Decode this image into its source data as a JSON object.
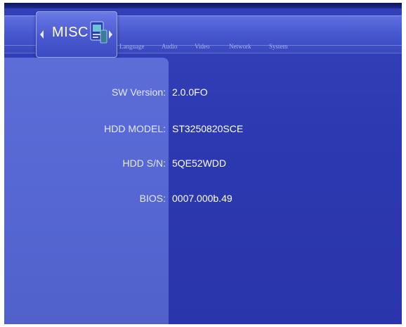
{
  "menu": {
    "selected_tab": "MISC",
    "tabs": [
      {
        "label": "Language"
      },
      {
        "label": "Audio"
      },
      {
        "label": "Video"
      },
      {
        "label": "Network"
      },
      {
        "label": "System"
      }
    ],
    "icons": {
      "left": "arrow-left-icon",
      "right": "arrow-right-icon",
      "misc": "misc-device-icon"
    }
  },
  "info": {
    "sw_version": {
      "label": "SW Version:",
      "value": "2.0.0FO"
    },
    "hdd_model": {
      "label": "HDD MODEL:",
      "value": "ST3250820SCE"
    },
    "hdd_sn": {
      "label": "HDD S/N:",
      "value": "5QE52WDD"
    },
    "bios": {
      "label": "BIOS:",
      "value": "0007.000b.49"
    }
  },
  "colors": {
    "background": "#2d39b0",
    "menu_bar": "#4858cf",
    "left_panel": "#5566d2",
    "text": "#ffffff",
    "inactive_tab": "#a7b1ec"
  }
}
